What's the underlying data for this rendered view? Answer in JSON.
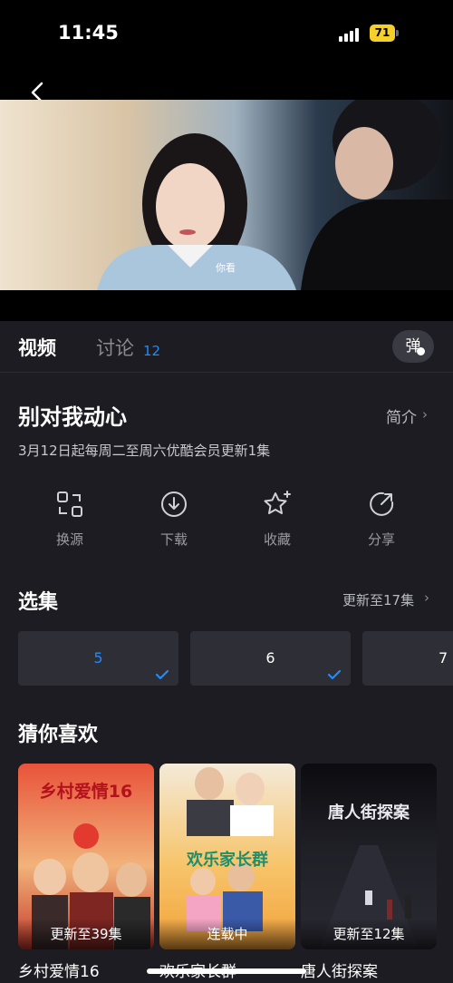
{
  "status_bar": {
    "time": "11:45",
    "battery": "71"
  },
  "video": {
    "subtitle": "你看"
  },
  "tabs": [
    {
      "label": "视频",
      "active": true
    },
    {
      "label": "讨论",
      "count": "12"
    }
  ],
  "danmu_label": "弹",
  "show": {
    "title": "别对我动心",
    "intro_label": "简介",
    "schedule": "3月12日起每周二至周六优酷会员更新1集"
  },
  "actions": [
    {
      "label": "换源",
      "icon": "switch-source-icon"
    },
    {
      "label": "下载",
      "icon": "download-icon"
    },
    {
      "label": "收藏",
      "icon": "star-add-icon"
    },
    {
      "label": "分享",
      "icon": "share-icon"
    }
  ],
  "episodes": {
    "title": "选集",
    "update_status": "更新至17集",
    "items": [
      {
        "number": "5",
        "selected": true,
        "watched": true
      },
      {
        "number": "6",
        "selected": false,
        "watched": true
      },
      {
        "number": "7",
        "selected": false,
        "watched": false
      }
    ]
  },
  "recommend": {
    "title": "猜你喜欢",
    "items": [
      {
        "title": "乡村爱情16",
        "poster_text": "乡村爱情16",
        "badge": "更新至39集"
      },
      {
        "title": "欢乐家长群",
        "poster_text": "欢乐家长群",
        "badge": "连载中"
      },
      {
        "title": "唐人街探案",
        "poster_text": "唐人街探案",
        "badge": "更新至12集"
      }
    ]
  },
  "colors": {
    "accent": "#1e8cff",
    "background": "#1c1c22",
    "card": "#2e2e36"
  }
}
